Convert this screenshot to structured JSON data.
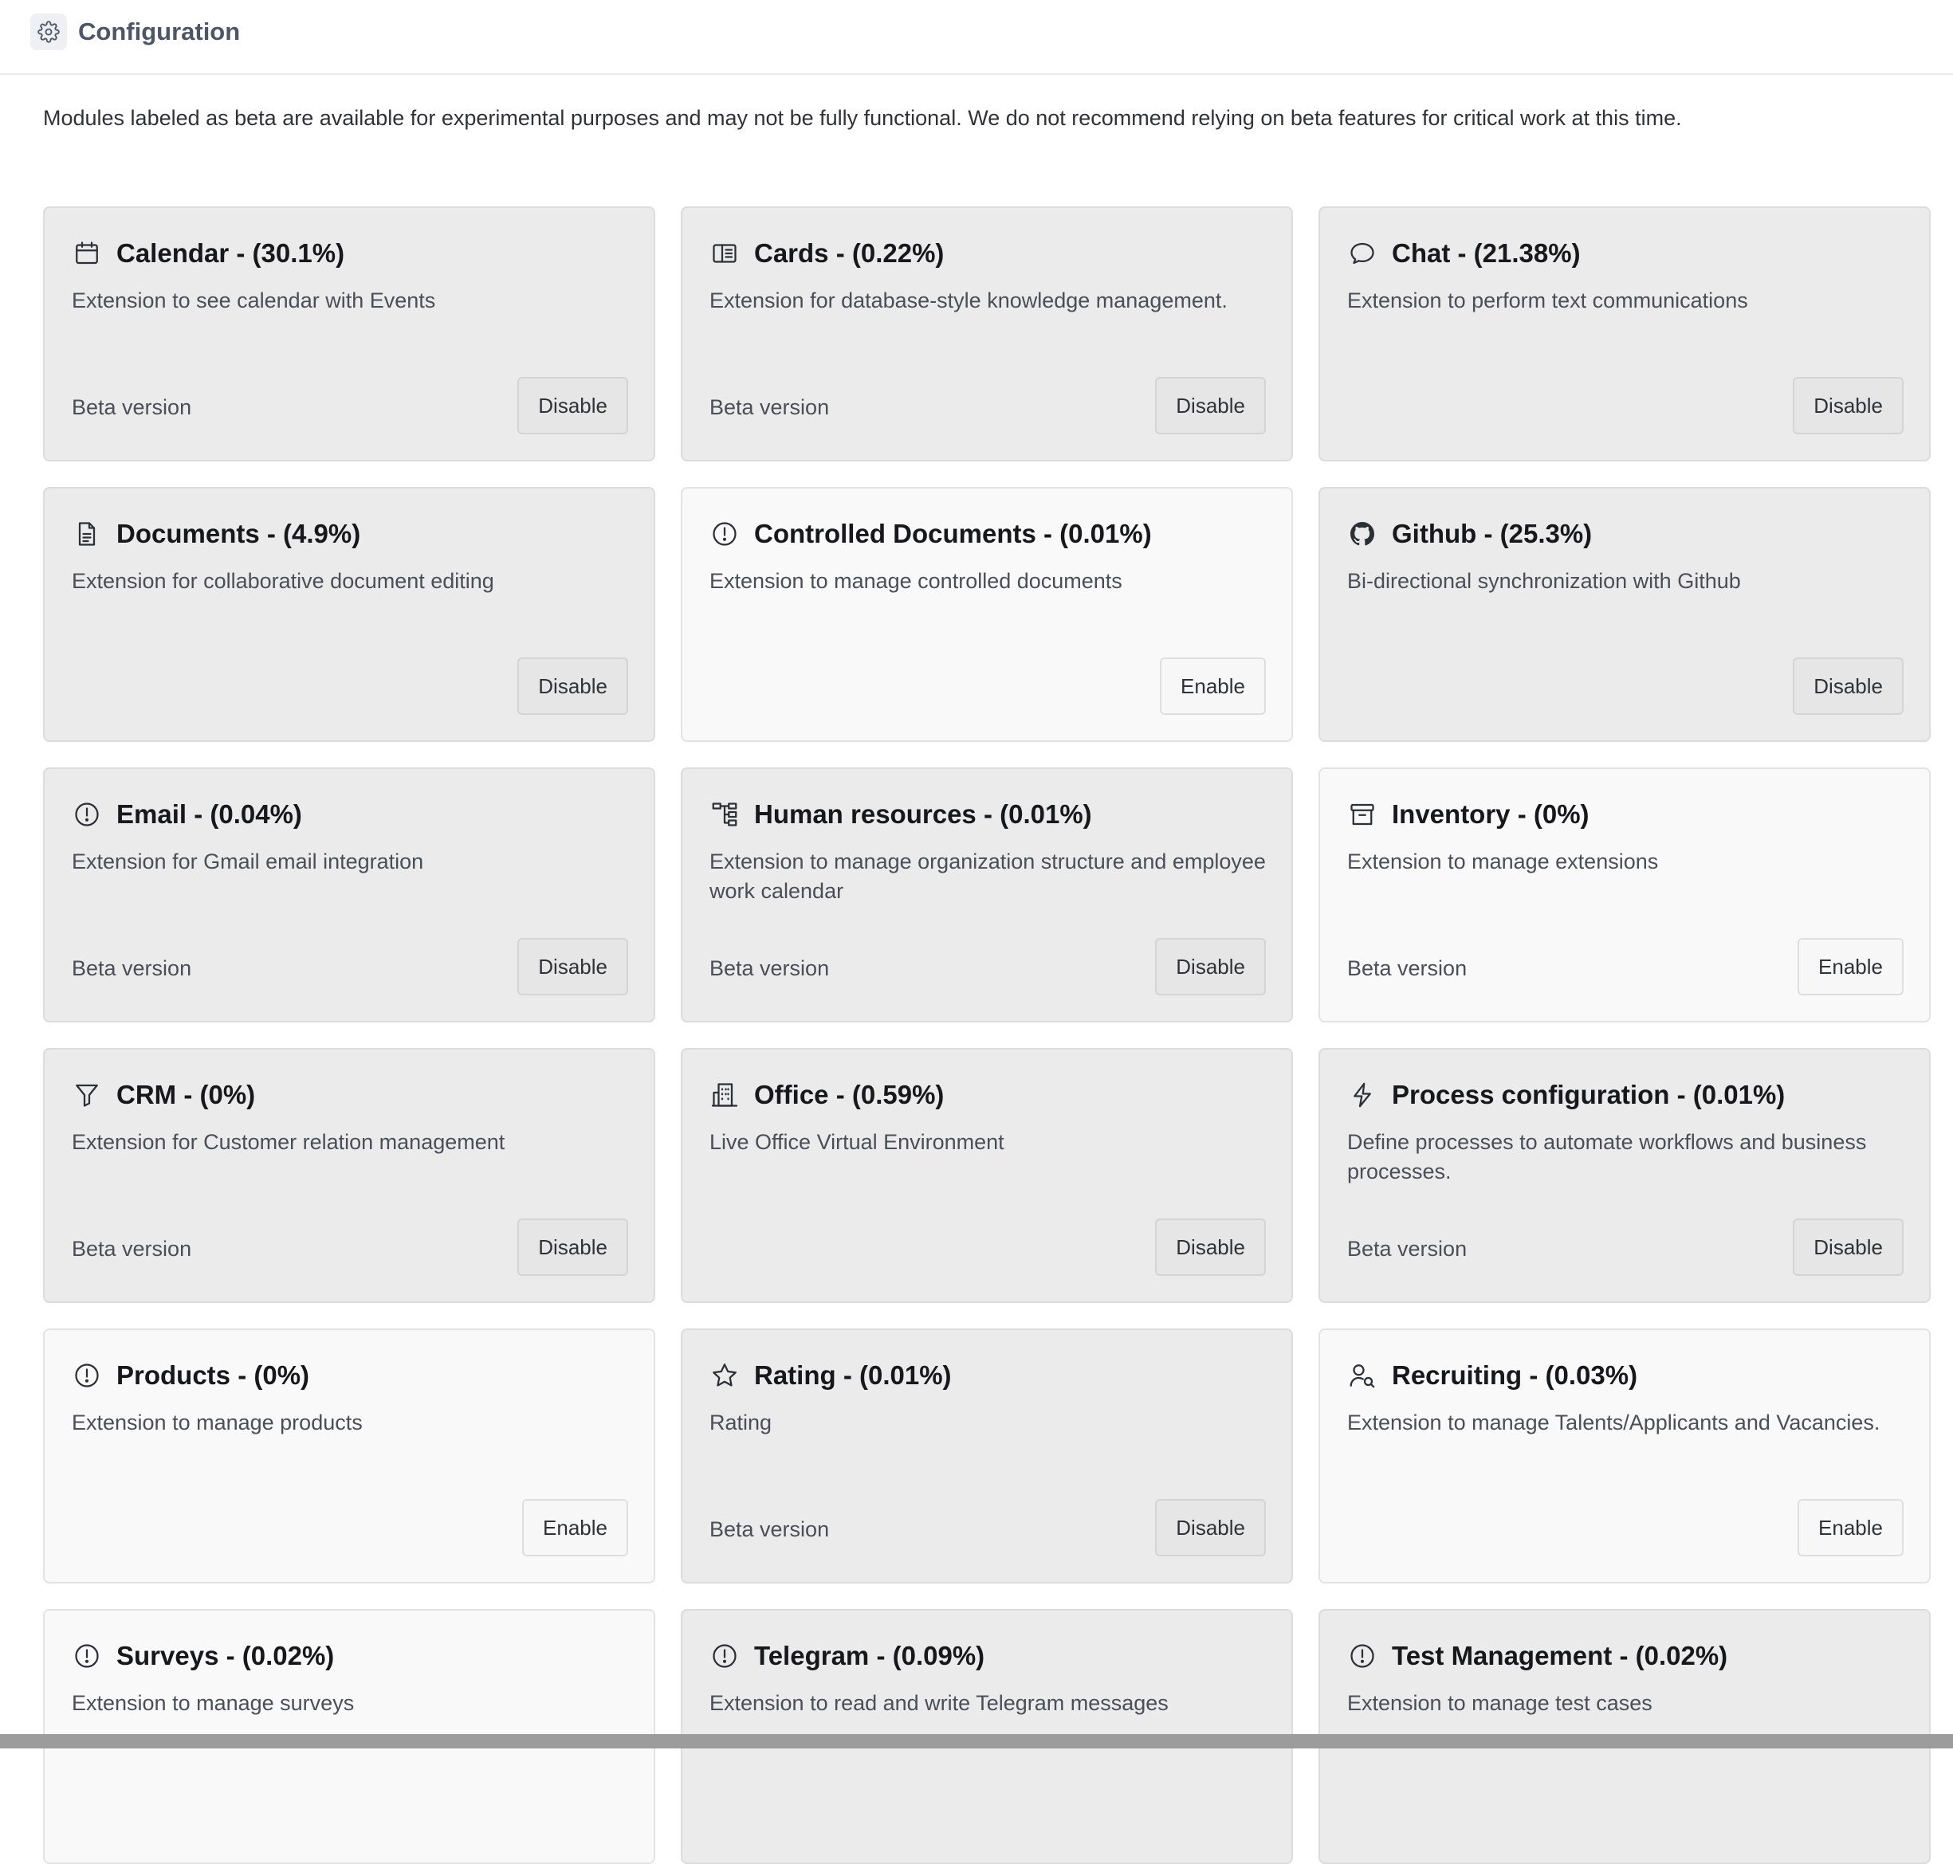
{
  "header": {
    "title": "Configuration",
    "icon": "gear-icon"
  },
  "notice": "Modules labeled as beta are available for experimental purposes and may not be fully functional. We do not recommend relying on beta features for critical work at this time.",
  "modules": [
    {
      "title": "Calendar - (30.1%)",
      "description": "Extension to see calendar with Events",
      "beta": "Beta version",
      "button": "Disable",
      "enabled": true,
      "icon": "calendar-icon"
    },
    {
      "title": "Cards - (0.22%)",
      "description": "Extension for database-style knowledge management.",
      "beta": "Beta version",
      "button": "Disable",
      "enabled": true,
      "icon": "cards-icon"
    },
    {
      "title": "Chat - (21.38%)",
      "description": "Extension to perform text communications",
      "beta": "",
      "button": "Disable",
      "enabled": true,
      "icon": "chat-icon"
    },
    {
      "title": "Documents - (4.9%)",
      "description": "Extension for collaborative document editing",
      "beta": "",
      "button": "Disable",
      "enabled": true,
      "icon": "document-icon"
    },
    {
      "title": "Controlled Documents - (0.01%)",
      "description": "Extension to manage controlled documents",
      "beta": "",
      "button": "Enable",
      "enabled": false,
      "icon": "info-icon"
    },
    {
      "title": "Github - (25.3%)",
      "description": "Bi-directional synchronization with Github",
      "beta": "",
      "button": "Disable",
      "enabled": true,
      "icon": "github-icon"
    },
    {
      "title": "Email - (0.04%)",
      "description": "Extension for Gmail email integration",
      "beta": "Beta version",
      "button": "Disable",
      "enabled": true,
      "icon": "info-icon"
    },
    {
      "title": "Human resources - (0.01%)",
      "description": "Extension to manage organization structure and employee work calendar",
      "beta": "Beta version",
      "button": "Disable",
      "enabled": true,
      "icon": "org-structure-icon"
    },
    {
      "title": "Inventory - (0%)",
      "description": "Extension to manage extensions",
      "beta": "Beta version",
      "button": "Enable",
      "enabled": false,
      "icon": "archive-icon"
    },
    {
      "title": "CRM - (0%)",
      "description": "Extension for Customer relation management",
      "beta": "Beta version",
      "button": "Disable",
      "enabled": true,
      "icon": "funnel-icon"
    },
    {
      "title": "Office - (0.59%)",
      "description": "Live Office Virtual Environment",
      "beta": "",
      "button": "Disable",
      "enabled": true,
      "icon": "building-icon"
    },
    {
      "title": "Process configuration - (0.01%)",
      "description": "Define processes to automate workflows and business processes.",
      "beta": "Beta version",
      "button": "Disable",
      "enabled": true,
      "icon": "lightning-icon"
    },
    {
      "title": "Products - (0%)",
      "description": "Extension to manage products",
      "beta": "",
      "button": "Enable",
      "enabled": false,
      "icon": "info-icon"
    },
    {
      "title": "Rating - (0.01%)",
      "description": "Rating",
      "beta": "Beta version",
      "button": "Disable",
      "enabled": true,
      "icon": "star-icon"
    },
    {
      "title": "Recruiting - (0.03%)",
      "description": "Extension to manage Talents/Applicants and Vacancies.",
      "beta": "",
      "button": "Enable",
      "enabled": false,
      "icon": "user-search-icon"
    },
    {
      "title": "Surveys - (0.02%)",
      "description": "Extension to manage surveys",
      "beta": "",
      "button": "",
      "enabled": false,
      "icon": "info-icon"
    },
    {
      "title": "Telegram - (0.09%)",
      "description": "Extension to read and write Telegram messages",
      "beta": "",
      "button": "",
      "enabled": true,
      "icon": "info-icon"
    },
    {
      "title": "Test Management - (0.02%)",
      "description": "Extension to manage test cases",
      "beta": "",
      "button": "",
      "enabled": true,
      "icon": "info-icon"
    }
  ]
}
